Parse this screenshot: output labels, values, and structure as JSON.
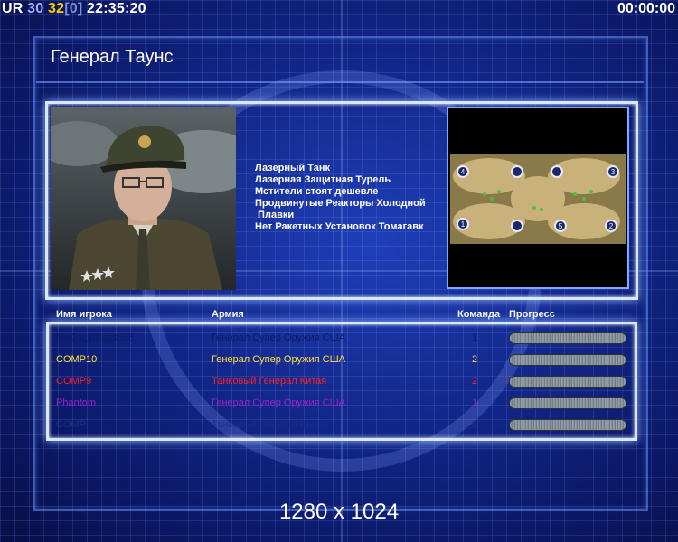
{
  "hud": {
    "ur": "UR",
    "fps": "30",
    "ping": "32",
    "bracket_value": "[0]",
    "clock": "22:35:20",
    "timer": "00:00:00"
  },
  "title": "Генерал Таунс",
  "general_features": [
    "Лазерный Танк",
    "Лазерная Защитная Турель",
    "Мстители стоят дешевле",
    "Продвинутые Реакторы Холодной",
    " Плавки",
    "Нет Ракетных Установок Томагавк"
  ],
  "minimap": {
    "start_positions": [
      "1",
      "2",
      "3",
      "4",
      "5"
    ]
  },
  "columns": {
    "player": "Имя игрока",
    "army": "Армия",
    "team": "Команда",
    "progress": "Прогресс"
  },
  "players": [
    {
      "name": "MeGa_BBoss666",
      "army": "Генерал Супер Оружия США",
      "team": "1",
      "color": "#0d1a66"
    },
    {
      "name": "COMP10",
      "army": "Генерал Супер Оружия США",
      "team": "2",
      "color": "#ffe033"
    },
    {
      "name": "COMP9",
      "army": "Танковый Генерал Китая",
      "team": "2",
      "color": "#ff2020"
    },
    {
      "name": "Phantom",
      "army": "Генерал Супер Оружия США",
      "team": "1",
      "color": "#9a22c8"
    },
    {
      "name": "COMP",
      "army": "Танковый Генерал Китая",
      "team": "2",
      "color": "#1a2d8a"
    }
  ],
  "resolution": "1280 x 1024",
  "colors": {
    "background": "#13288c",
    "panel_border": "#d8e8ff",
    "accent": "#ffd200"
  }
}
